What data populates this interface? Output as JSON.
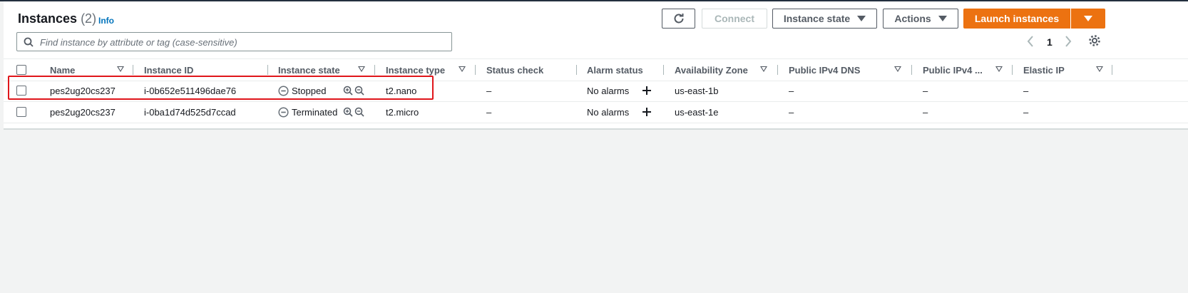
{
  "header": {
    "title": "Instances",
    "count": "(2)",
    "info_label": "Info"
  },
  "toolbar": {
    "refresh_icon": "refresh-icon",
    "connect_label": "Connect",
    "instance_state_label": "Instance state",
    "actions_label": "Actions",
    "launch_label": "Launch instances"
  },
  "search": {
    "placeholder": "Find instance by attribute or tag (case-sensitive)",
    "value": ""
  },
  "pagination": {
    "page": "1"
  },
  "columns": [
    "Name",
    "Instance ID",
    "Instance state",
    "Instance type",
    "Status check",
    "Alarm status",
    "Availability Zone",
    "Public IPv4 DNS",
    "Public IPv4 ...",
    "Elastic IP"
  ],
  "rows": [
    {
      "name": "pes2ug20cs237",
      "instance_id": "i-0b652e511496dae76",
      "state": "Stopped",
      "type": "t2.nano",
      "status_check": "–",
      "alarm": "No alarms",
      "az": "us-east-1b",
      "dns": "–",
      "ipv4": "–",
      "elastic_ip": "–"
    },
    {
      "name": "pes2ug20cs237",
      "instance_id": "i-0ba1d74d525d7ccad",
      "state": "Terminated",
      "type": "t2.micro",
      "status_check": "–",
      "alarm": "No alarms",
      "az": "us-east-1e",
      "dns": "–",
      "ipv4": "–",
      "elastic_ip": "–"
    }
  ],
  "colors": {
    "primary": "#ec7211",
    "link": "#0073bb",
    "highlight": "#e0161b"
  }
}
